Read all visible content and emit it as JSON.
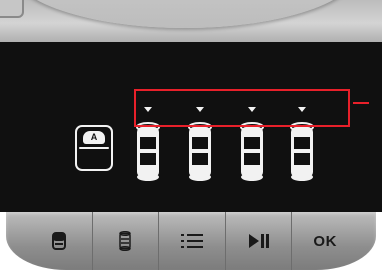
{
  "screen": {
    "stitch_icon_label": "A",
    "bobbin_count": 4
  },
  "softkeys": {
    "ok_label": "OK",
    "icons": [
      "stitch-card-icon",
      "bobbin-icon",
      "list-icon",
      "play-pause-icon"
    ]
  },
  "colors": {
    "highlight": "#e8202a",
    "screen_bg": "#101010",
    "icon_fg": "#f2f2f2",
    "button_bar": "#9a9a9a"
  }
}
